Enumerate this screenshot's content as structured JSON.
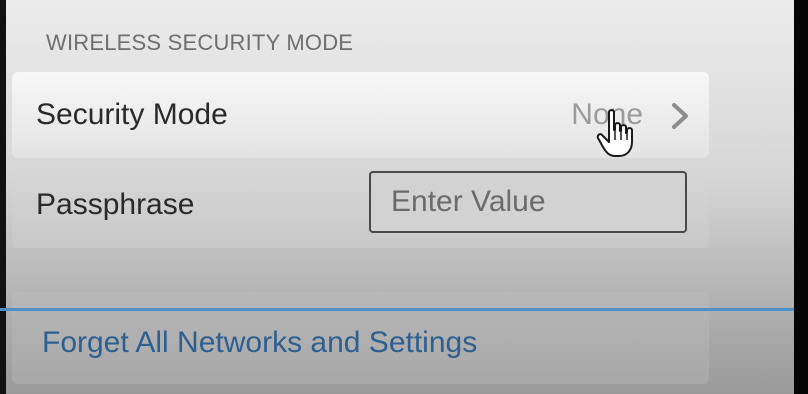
{
  "section": {
    "header": "WIRELESS SECURITY MODE"
  },
  "security_mode": {
    "label": "Security Mode",
    "value": "None",
    "chevron_icon": "chevron-right-icon"
  },
  "passphrase": {
    "label": "Passphrase",
    "placeholder": "Enter Value",
    "value": ""
  },
  "forget": {
    "label": "Forget All Networks and Settings"
  },
  "cursor_icon": "hand-pointer-icon",
  "colors": {
    "link": "#2e5f8f",
    "divider": "#4d8fc9",
    "label": "#2a2a2a",
    "value": "#9b9b9b",
    "header": "#6f6f6f"
  }
}
